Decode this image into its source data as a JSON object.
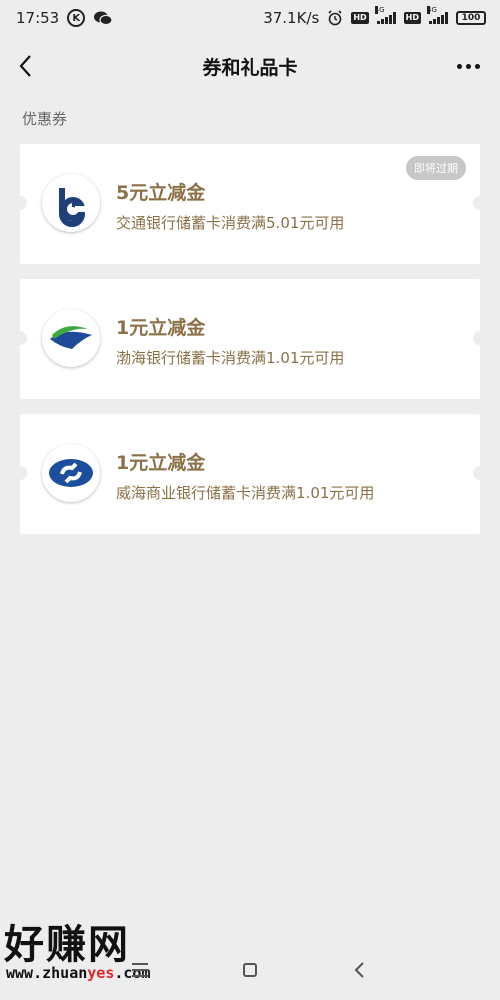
{
  "status_bar": {
    "time": "17:53",
    "k_icon_letter": "K",
    "network_speed": "37.1K/s",
    "hd1": "HD",
    "hd2": "HD",
    "signal_label_1": "4G",
    "signal_label_2": "4G",
    "battery": "100"
  },
  "nav": {
    "title": "券和礼品卡"
  },
  "section": {
    "label": "优惠券"
  },
  "coupons": [
    {
      "title": "5元立减金",
      "description": "交通银行储蓄卡消费满5.01元可用",
      "badge": "即将过期",
      "logo_icon": "bocom-logo-icon"
    },
    {
      "title": "1元立减金",
      "description": "渤海银行储蓄卡消费满1.01元可用",
      "logo_icon": "bohai-bank-logo-icon"
    },
    {
      "title": "1元立减金",
      "description": "威海商业银行储蓄卡消费满1.01元可用",
      "logo_icon": "weihai-bank-logo-icon"
    }
  ],
  "watermark": {
    "big": "好赚网",
    "small_pre": "www.zhuan",
    "small_yes": "yes",
    "small_post": ".com"
  },
  "colors": {
    "background": "#ededed",
    "coupon_text": "#8b7148",
    "badge_bg": "#c7c7c7"
  }
}
